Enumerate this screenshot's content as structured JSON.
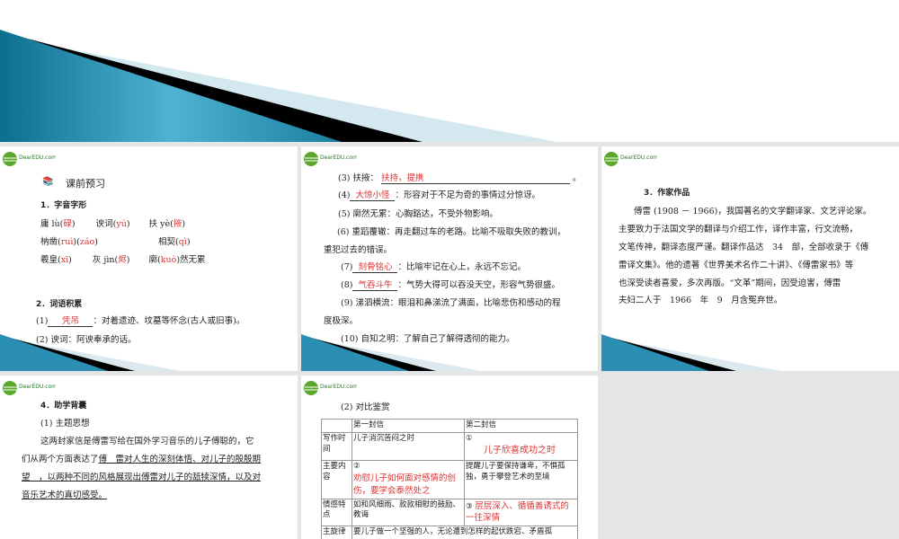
{
  "logo_text": "DearEDU.com",
  "slide1": {
    "heading": "课前预习",
    "s1": "1．字音字形",
    "r1": [
      {
        "pre": "庸 lù(",
        "ans": "碌",
        "post": ")"
      },
      {
        "pre": "谀词(",
        "ans": "yú",
        "post": ")"
      },
      {
        "pre": "扶 yè(",
        "ans": "掖",
        "post": ")"
      }
    ],
    "r2": [
      {
        "pre": "枘凿(",
        "ans": "ruì",
        "post": ")("
      },
      {
        "pre": "",
        "ans": "záo",
        "post": ")"
      },
      {
        "pre": "相契(",
        "ans": "qì",
        "post": ")"
      }
    ],
    "r3": [
      {
        "pre": "羲皇(",
        "ans": "xī",
        "post": ")"
      },
      {
        "pre": "灰 jìn(",
        "ans": "烬",
        "post": ")"
      },
      {
        "pre": "廓(",
        "ans": "kuò",
        "post": ")然无累"
      }
    ],
    "s2": "2．词语积累",
    "i1_num": "(1)",
    "i1_ans": "凭吊",
    "i1_text": "：对着遗迹、坟墓等怀念(古人或旧事)。",
    "i2": "(2) 谀词：阿谀奉承的话。"
  },
  "slide2": {
    "i3_pre": "(3) 扶掖：",
    "i3_ans": "扶持，提携",
    "i3_post": "。",
    "i4_num": "(4)",
    "i4_ans": "大惊小怪",
    "i4_text": "：形容对于不足为奇的事情过分惊讶。",
    "i5": "(5) 廓然无累：心胸豁达，不受外物影响。",
    "i6a": "(6) 重蹈覆辙：再走翻过车的老路。比喻不吸取失败的教训，",
    "i6b": "重犯过去的错误。",
    "i7_num": "(7)",
    "i7_ans": "刻骨铭心",
    "i7_text": "：比喻牢记在心上，永远不忘记。",
    "i8_num": "(8)",
    "i8_ans": "气吞斗牛",
    "i8_text": "：气势大得可以吞没天空，形容气势很盛。",
    "i9a": "(9) 涕泗横流：眼泪和鼻涕流了满面，比喻悲伤和感动的程",
    "i9b": "度极深。",
    "i10": "(10) 自知之明：了解自己了解得透彻的能力。"
  },
  "slide3": {
    "heading": "3．作家作品",
    "lines": [
      "傅雷 (1908 － 1966)，我国著名的文学翻译家、文艺评论家。",
      "主要致力于法国文学的翻译与介绍工作，译作丰富，行文流畅，",
      "文笔传神，翻译态度严谨。翻译作品达　34　部，全部收录于《傅",
      "雷译文集》。他的遗著《世界美术名作二十讲》、《傅雷家书》等",
      "也深受读者喜爱，多次再版。“文革”期间，因受迫害，傅雷",
      "夫妇二人于　1966　年　9　月含冤弃世。"
    ]
  },
  "slide4": {
    "heading": "4．助学背囊",
    "sub": "(1) 主题思想",
    "l1": "这两封家信是傅雷写给在国外学习音乐的儿子傅聪的，它",
    "l2a": "们从两个方面表达了",
    "l2b": "傅　雷对人生的深刻体悟、对儿子的殷殷期",
    "l3": "望　，以两种不同的风格展现出傅雷对儿子的舐犊深情，以及对",
    "l4": "音乐艺术的真切感受。"
  },
  "slide5": {
    "heading": "(2) 对比鉴赏",
    "cols": [
      "",
      "第一封信",
      "第二封信"
    ],
    "rows": [
      {
        "h": "写作时间",
        "c1": "儿子消沉苦闷之时",
        "c2_mark": "①",
        "c2_ans": "儿子欣喜成功之时"
      },
      {
        "h": "主要内容",
        "c1_mark": "②",
        "c1_ans": "劝慰儿子如何面对感情的创伤，要学会泰然处之",
        "c2": "提醒儿子要保持谦卑，不惧孤独，勇于攀登艺术的至境"
      },
      {
        "h": "情感特点",
        "c1": "如和风细雨、款款相慰的鼓励、教诲",
        "c2_mark": "③",
        "c2_ans": "层层深入、循循善诱式的一往深情"
      }
    ],
    "last_h": "主旋律",
    "last_text": "要儿子做一个坚强的人，无论遭到怎样的起伏跌宕、矛盾孤"
  }
}
